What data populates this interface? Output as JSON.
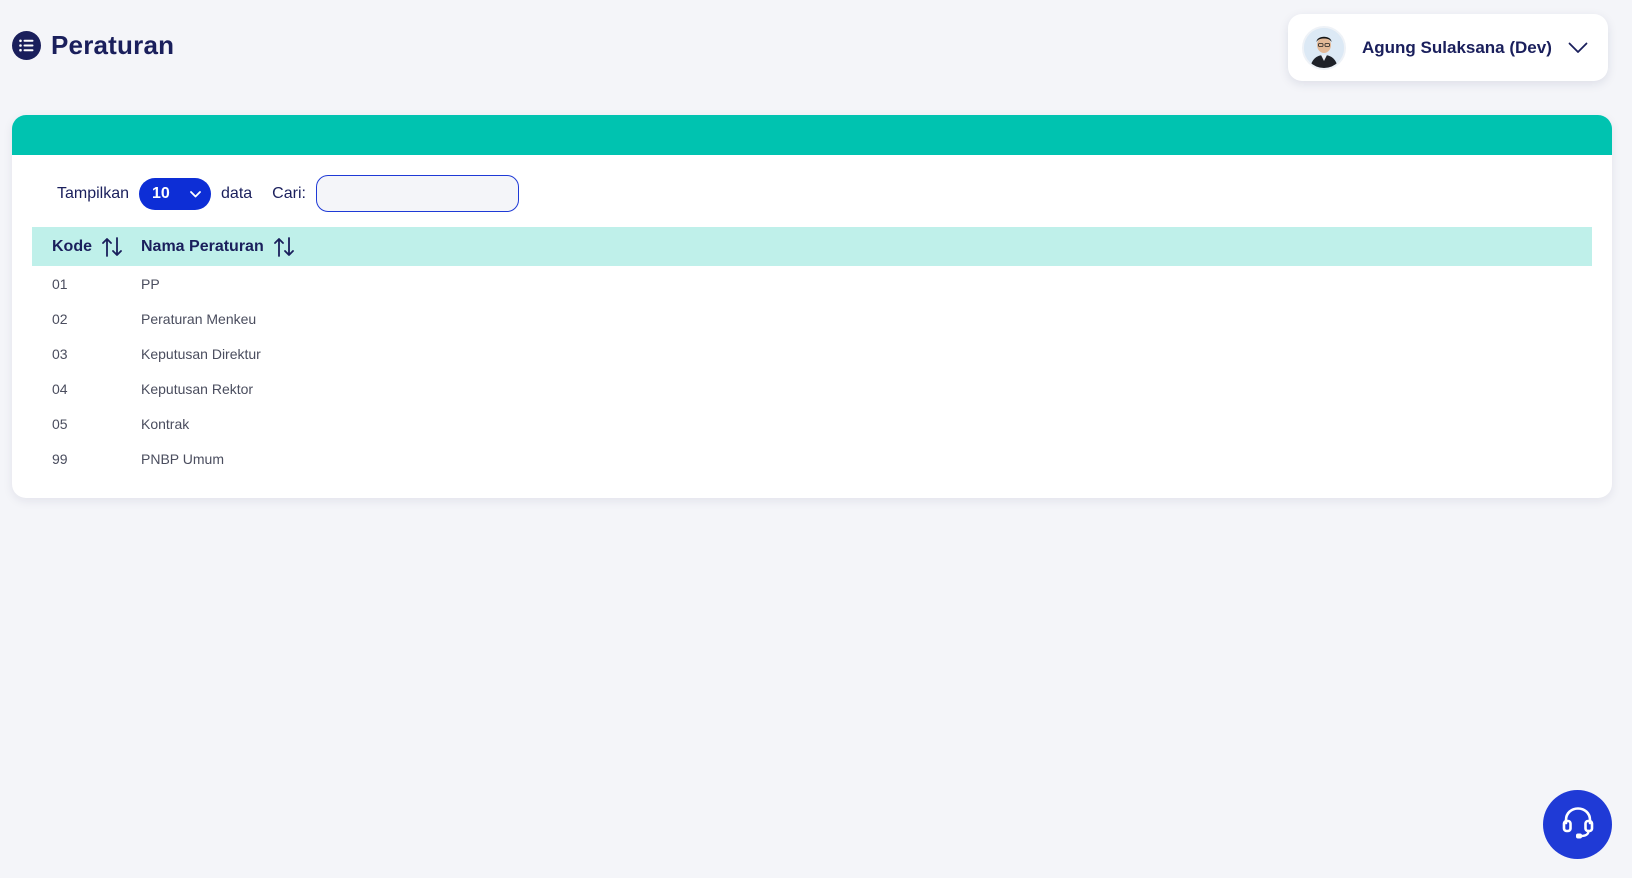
{
  "header": {
    "title": "Peraturan"
  },
  "user": {
    "name": "Agung Sulaksana (Dev)"
  },
  "controls": {
    "show_label": "Tampilkan",
    "page_length_value": "10",
    "data_label": "data",
    "search_label": "Cari:",
    "search_value": "",
    "search_placeholder": ""
  },
  "table": {
    "columns": [
      "Kode",
      "Nama Peraturan"
    ],
    "rows": [
      {
        "kode": "01",
        "nama": "PP"
      },
      {
        "kode": "02",
        "nama": "Peraturan Menkeu"
      },
      {
        "kode": "03",
        "nama": "Keputusan Direktur"
      },
      {
        "kode": "04",
        "nama": "Keputusan Rektor"
      },
      {
        "kode": "05",
        "nama": "Kontrak"
      },
      {
        "kode": "99",
        "nama": "PNBP Umum"
      }
    ]
  },
  "icons": {
    "title": "list-icon",
    "user_menu": "chevron-down-icon",
    "sort": "sort-icon",
    "support": "headset-icon"
  },
  "colors": {
    "brand_navy": "#1a1f5c",
    "accent_teal": "#00c3b0",
    "header_row": "#bff0ea",
    "primary_blue": "#0d2ed6"
  }
}
